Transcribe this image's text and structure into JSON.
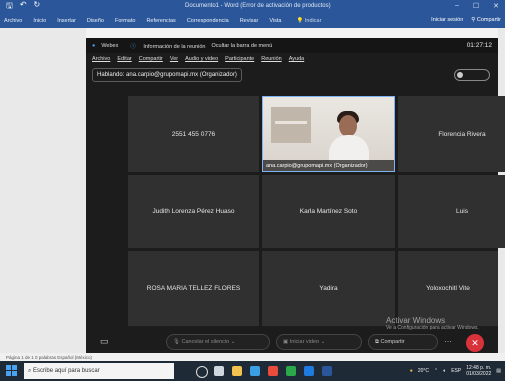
{
  "word": {
    "doc_title": "Documento1 - Word (Error de activación de productos)",
    "tabs": [
      "Archivo",
      "Inicio",
      "Insertar",
      "Diseño",
      "Formato",
      "Referencias",
      "Correspondencia",
      "Revisar",
      "Vista"
    ],
    "search": "Indicar",
    "signin": "Iniciar sesión",
    "share": "Compartir",
    "status": "Página 1 de 1   0 palabras   Español (México)"
  },
  "webex": {
    "app_name": "Webex",
    "meeting_info": "Información de la reunión",
    "hide_menu": "Ocultar la barra de menú",
    "time": "01:27:12",
    "menu": [
      "Archivo",
      "Editar",
      "Compartir",
      "Ver",
      "Audio y video",
      "Participante",
      "Reunión",
      "Ayuda"
    ],
    "speaking": "Hablando: ana.carpio@grupomapi.mx (Organizador)",
    "participants": [
      "2551 455 0776",
      "",
      "Florencia Rivera",
      "Judith Lorenza Pérez Huaso",
      "Karla Martínez Soto",
      "Luis",
      "ROSA MARIA TELLEZ FLORES",
      "Yadira",
      "Yoloxochitl Vite"
    ],
    "active_caption": "ana.carpio@grupomapi.mx (Organizador)",
    "controls": {
      "mute": "Cancelar el silencio",
      "video": "Iniciar video",
      "share": "Compartir"
    }
  },
  "activate": {
    "line1": "Activar Windows",
    "line2": "Ve a Configuración para activar Windows."
  },
  "taskbar": {
    "search": "Escribe aquí para buscar",
    "weather": "20°C",
    "lang": "ESP",
    "time": "12:48 p. m.",
    "date": "01/03/2022"
  },
  "colors": {
    "word_blue": "#2b579a",
    "webex_bg": "#1c1c1c",
    "tile_bg": "#303030",
    "end_red": "#d9323b",
    "active_border": "#7fb4f4"
  }
}
